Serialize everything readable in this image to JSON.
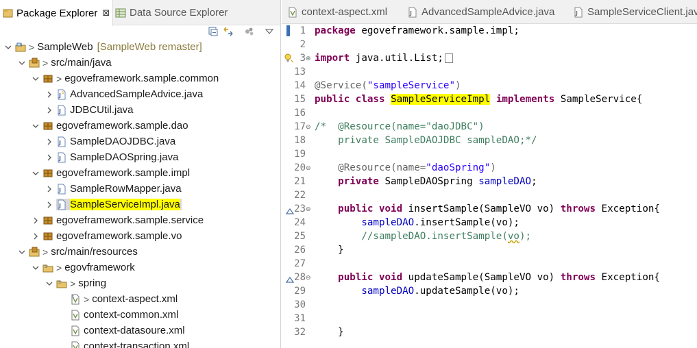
{
  "left_tabs": [
    {
      "label": "Package Explorer",
      "close": "⊠"
    },
    {
      "label": "Data Source Explorer"
    }
  ],
  "tree": {
    "project": {
      "label": "SampleWeb",
      "suffix": "[SampleWeb remaster]"
    },
    "src_java": {
      "label": "src/main/java"
    },
    "pkg_common": {
      "label": "egoveframework.sample.common"
    },
    "file_advice": {
      "label": "AdvancedSampleAdvice.java"
    },
    "file_jdbcutil": {
      "label": "JDBCUtil.java"
    },
    "pkg_dao": {
      "label": "egoveframework.sample.dao"
    },
    "file_daojdbc": {
      "label": "SampleDAOJDBC.java"
    },
    "file_daospring": {
      "label": "SampleDAOSpring.java"
    },
    "pkg_impl": {
      "label": "egoveframework.sample.impl"
    },
    "file_rowmapper": {
      "label": "SampleRowMapper.java"
    },
    "file_serviceimpl": {
      "label": "SampleServiceImpl.java"
    },
    "pkg_service": {
      "label": "egoveframework.sample.service"
    },
    "pkg_vo": {
      "label": "egoveframework.sample.vo"
    },
    "src_resources": {
      "label": "src/main/resources"
    },
    "folder_egov": {
      "label": "egovframework"
    },
    "folder_spring": {
      "label": "spring"
    },
    "xml_aspect": {
      "label": "context-aspect.xml"
    },
    "xml_common": {
      "label": "context-common.xml"
    },
    "xml_datasource": {
      "label": "context-datasoure.xml"
    },
    "xml_transaction": {
      "label": "context-transaction.xml"
    }
  },
  "editor_tabs": [
    {
      "label": "context-aspect.xml"
    },
    {
      "label": "AdvancedSampleAdvice.java"
    },
    {
      "label": "SampleServiceClient.java"
    }
  ],
  "code": {
    "line_numbers": [
      "1",
      "2",
      "3",
      "13",
      "14",
      "15",
      "16",
      "17",
      "18",
      "19",
      "20",
      "21",
      "22",
      "23",
      "24",
      "25",
      "26",
      "27",
      "28",
      "29",
      "30",
      "31",
      "32"
    ],
    "l1_kw": "package",
    "l1_rest": " egoveframework.sample.impl;",
    "l3_kw": "import",
    "l3_rest": " java.util.List;",
    "l14_ann": "@Service(",
    "l14_str": "\"sampleService\"",
    "l14_end": ")",
    "l15_kw1": "public",
    "l15_kw2": "class",
    "l15_cls": "SampleServiceImpl",
    "l15_kw3": "implements",
    "l15_rest": " SampleService{",
    "l17_a": "/*  ",
    "l17_ann": "@Resource(name=\"daoJDBC\")",
    "l18": "    private SampleDAOJDBC sampleDAO;*/",
    "l20_ann": "@Resource(name=",
    "l20_str": "\"daoSpring\"",
    "l20_end": ")",
    "l21_kw": "private",
    "l21_type": " SampleDAOSpring ",
    "l21_fld": "sampleDAO",
    "l21_end": ";",
    "l23_kw1": "public",
    "l23_kw2": "void",
    "l23_sig": " insertSample(SampleVO vo) ",
    "l23_kw3": "throws",
    "l23_end": " Exception{",
    "l24_fld": "sampleDAO",
    "l24_rest": ".insertSample(vo);",
    "l25_a": "//sampleDAO.insertSample(",
    "l25_vo": "vo",
    "l25_b": ");",
    "l26": "}",
    "l28_kw1": "public",
    "l28_kw2": "void",
    "l28_sig": " updateSample(SampleVO vo) ",
    "l28_kw3": "throws",
    "l28_end": " Exception{",
    "l29_fld": "sampleDAO",
    "l29_rest": ".updateSample(vo);",
    "l32": "}"
  },
  "colors": {
    "highlight": "#ffff00",
    "keyword": "#7f0055",
    "string": "#2a00ff",
    "comment": "#3f7f5f",
    "field": "#0000c0"
  },
  "icons": [
    "package-explorer-icon",
    "data-source-explorer-icon",
    "collapse-all-icon",
    "link-editor-icon",
    "view-menu-icon",
    "project-icon",
    "source-folder-icon",
    "package-icon",
    "java-file-icon",
    "xml-file-icon",
    "folder-icon"
  ]
}
